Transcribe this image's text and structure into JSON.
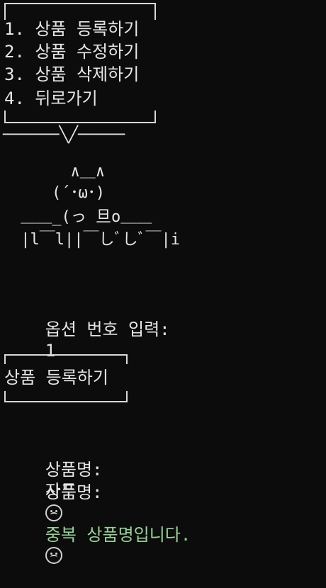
{
  "menu": {
    "items": [
      "1. 상품 등록하기",
      "2. 상품 수정하기",
      "3. 상품 삭제하기",
      "4. 뒤로가기"
    ]
  },
  "bubble_line": "──────╲╱─────",
  "ascii_art": [
    "      ∧＿∧",
    "    (´･ω･)",
    " ＿＿_(っ 旦o＿＿",
    " |l￣l||￣しﾞしﾞ￣|i"
  ],
  "prompt": {
    "label": "옵션 번호 입력:",
    "value": "1"
  },
  "section_title": "상품 등록하기",
  "product_input": {
    "label": "상품명:",
    "value": "자두"
  },
  "error_line": {
    "label": "상품명:",
    "message": "중복 상품명입니다."
  }
}
